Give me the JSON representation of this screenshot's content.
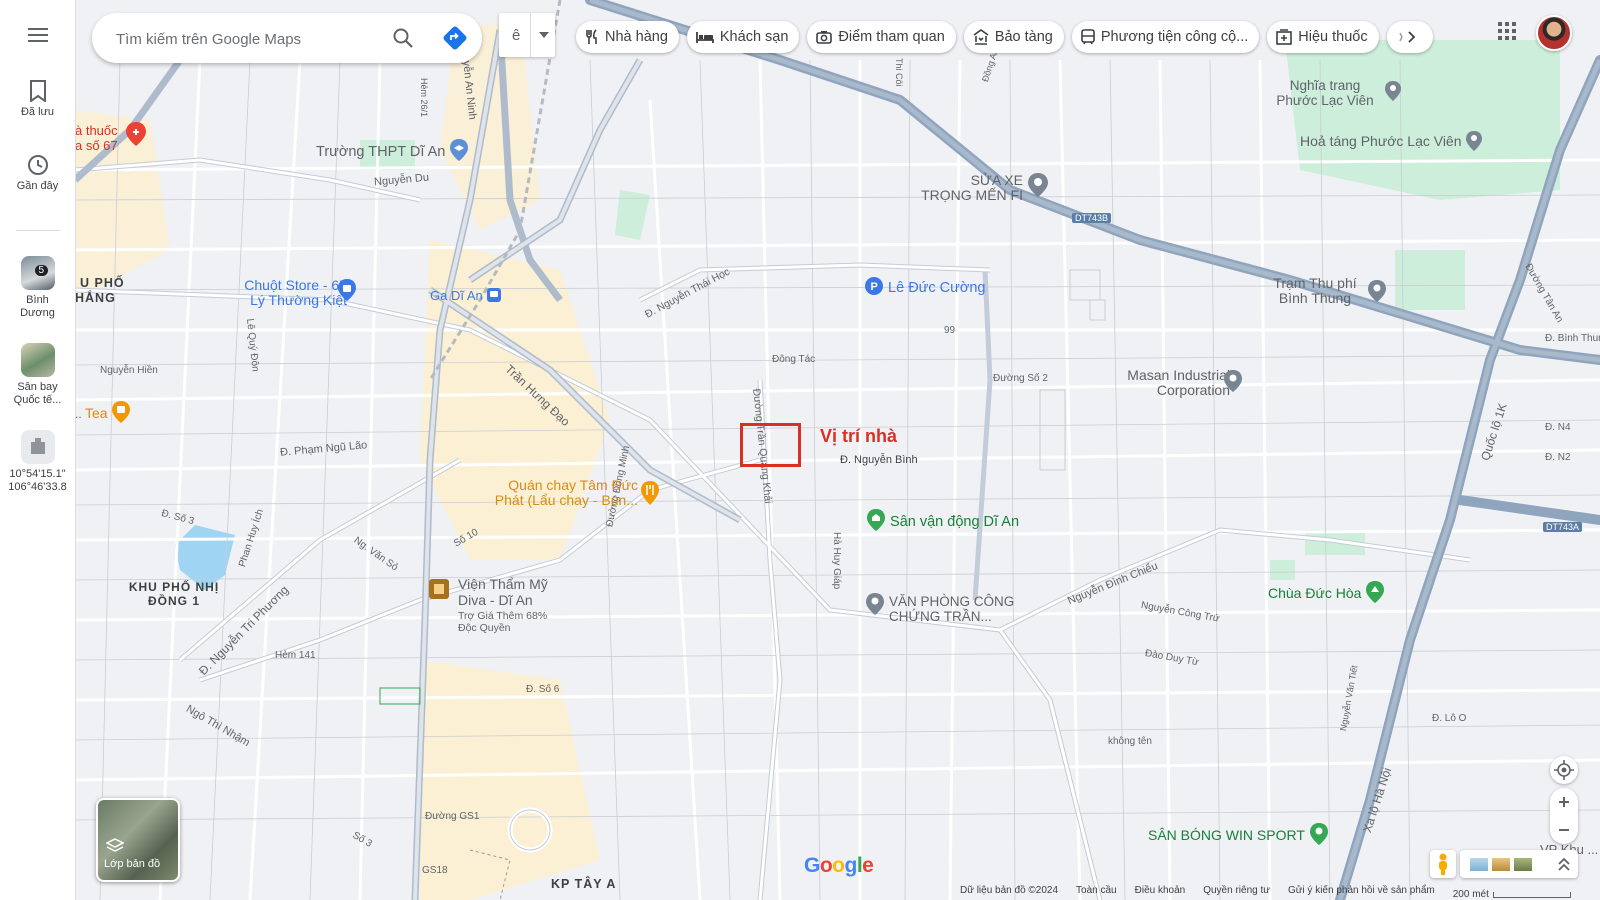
{
  "search": {
    "placeholder": "Tìm kiếm trên Google Maps"
  },
  "ime": {
    "label": "ê"
  },
  "chips": [
    {
      "label": "Nhà hàng",
      "icon": "restaurant-icon"
    },
    {
      "label": "Khách sạn",
      "icon": "hotel-icon"
    },
    {
      "label": "Điểm tham quan",
      "icon": "camera-icon"
    },
    {
      "label": "Bảo tàng",
      "icon": "museum-icon"
    },
    {
      "label": "Phương tiện công cộ...",
      "icon": "transit-icon"
    },
    {
      "label": "Hiệu thuốc",
      "icon": "pharmacy-icon"
    }
  ],
  "rail": {
    "saved": "Đã lưu",
    "recent": "Gần đây",
    "recents": [
      {
        "label1": "Bình",
        "label2": "Dương",
        "badge": "5"
      },
      {
        "label1": "Sân bay",
        "label2": "Quốc tế..."
      },
      {
        "label1": "10°54'15.1\"",
        "label2": "106°46'33.8"
      }
    ]
  },
  "layers_label": "Lớp bản đồ",
  "annotation": {
    "label": "Vị trí nhà",
    "color": "#d93025"
  },
  "streets": [
    "Nguyễn An Ninh",
    "Trần Hưng Đạo",
    "Đường Trần Quang Khải",
    "Đ. Nguyễn Bình",
    "Đ. Nguyễn Thái Học",
    "Đông Tác",
    "Đường Số 2",
    "Hà Huy Giáp",
    "Đường Đông Minh",
    "Đ. Phạm Ngũ Lão",
    "Đ. Nguyễn Tri Phương",
    "Ngô Thì Nhậm",
    "Nguyễn Du",
    "Lê Quý Đôn",
    "Nguyễn Hiền",
    "Phan Huy Ích",
    "Ng. Văn Sỏ",
    "Số 10",
    "Đ. Số 6",
    "Đường GS1",
    "GS18",
    "Hẻm 141",
    "Nguyễn Đình Chiểu",
    "Nguyễn Công Trứ",
    "Đào Duy Từ",
    "không tên",
    "Xa lộ Hà Nội",
    "Quốc lộ 1K",
    "Đ. Bình Thung",
    "Đ. Lô O",
    "Đ. N4",
    "Đ. N2",
    "Đ. Số 3",
    "Đường Tân An",
    "Đường Nguyễn Bình",
    "Nguyễn Văn Tiết",
    "Hẻm 26/1",
    "Thi Côi",
    "Đồng An",
    "Số 3",
    "Đ. Số 3"
  ],
  "route_badges": [
    "DT743B",
    "DT743A",
    "99"
  ],
  "area_labels": [
    "KHU PHỐ NHỊ ĐỒNG 1",
    "KP TÂY A",
    "U PHỐ",
    "HẮNG"
  ],
  "pois": [
    {
      "name": "Trường THPT Dĩ An",
      "color": "#5f6368",
      "pin": "#5c8fd6"
    },
    {
      "name": "Chuột Store - 67 Lý Thường Kiệt",
      "color": "#3b78e7",
      "pin": "#3b78e7"
    },
    {
      "name": "Ga Dĩ An",
      "color": "#3b78e7",
      "pin": "#3b78e7"
    },
    {
      "name": "Lê Đức Cường",
      "color": "#3b78e7",
      "pin": "#3b78e7"
    },
    {
      "name": "SỬA XE TRỌNG MẾN FI",
      "color": "#5f6368",
      "pin": "#7a8594"
    },
    {
      "name": "Nghĩa trang Phước Lạc Viên",
      "color": "#5f6368",
      "pin": "#7a8594"
    },
    {
      "name": "Hoả táng Phước Lạc Viên",
      "color": "#5f6368",
      "pin": "#7a8594"
    },
    {
      "name": "Trạm Thu phí Bình Thung",
      "color": "#5f6368",
      "pin": "#7a8594"
    },
    {
      "name": "Masan Industrial Corporation",
      "color": "#5f6368",
      "pin": "#7a8594"
    },
    {
      "name": "Quán chay Tâm Đức Phát (Lẩu chay - Bún...",
      "color": "#e8a33b",
      "pin": "#f29900"
    },
    {
      "name": "Sân vận động Dĩ An",
      "color": "#188038",
      "pin": "#34a853"
    },
    {
      "name": "VĂN PHÒNG CÔNG CHỨNG TRẦN...",
      "color": "#5f6368",
      "pin": "#7a8594"
    },
    {
      "name": "Viện Thẩm Mỹ Diva - Dĩ An",
      "color": "#5f6368",
      "pin": "#a8721d"
    },
    {
      "name": "Trợ Giá Thêm 68% Độc Quyền",
      "color": "#5f6368"
    },
    {
      "name": "Chùa Đức Hòa",
      "color": "#188038",
      "pin": "#34a853"
    },
    {
      "name": "SÂN BÓNG WIN SPORT",
      "color": "#188038",
      "pin": "#34a853"
    },
    {
      "name": "Tea",
      "color": "#e8a33b",
      "pin": "#f29900"
    },
    {
      "name": "à thuốc a số 67",
      "color": "#d93025",
      "pin": "#ea4335"
    },
    {
      "name": "VP Khu ... An",
      "color": "#5f6368"
    }
  ],
  "logo": "Google",
  "footer": [
    "Dữ liệu bản đồ ©2024",
    "Toàn cầu",
    "Điều khoản",
    "Quyền riêng tư",
    "Gửi ý kiến phản hồi về sản phẩm",
    "200 mét"
  ]
}
